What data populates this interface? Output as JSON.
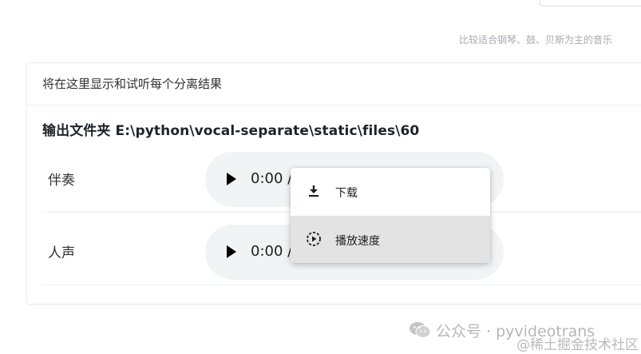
{
  "hint": {
    "text": "比较适合钢琴、鼓、贝斯为主的音乐"
  },
  "card": {
    "header": "将在这里显示和试听每个分离结果",
    "output_folder": "输出文件夹 E:\\python\\vocal-separate\\static\\files\\60"
  },
  "tracks": [
    {
      "label": "伴奏",
      "time": "0:00 /"
    },
    {
      "label": "人声",
      "time": "0:00 /"
    }
  ],
  "context_menu": {
    "items": [
      {
        "label": "下载",
        "icon": "download-icon"
      },
      {
        "label": "播放速度",
        "icon": "playback-speed-icon"
      }
    ]
  },
  "watermark": {
    "text": "公众号 · pyvideotrans",
    "site": "@稀土掘金技术社区"
  }
}
